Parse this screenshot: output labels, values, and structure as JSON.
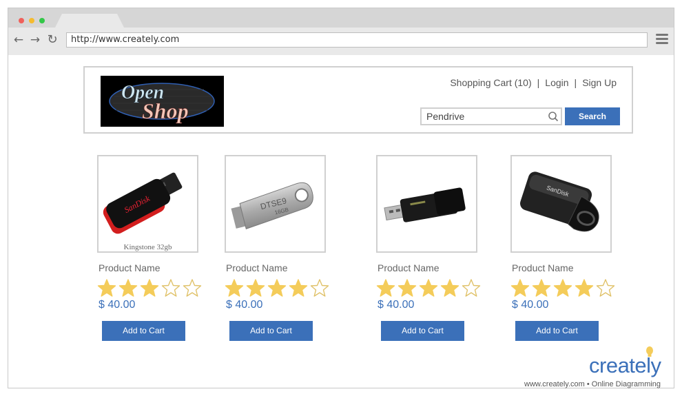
{
  "browser": {
    "url": "http://www.creately.com",
    "back_icon": "←",
    "forward_icon": "→",
    "reload_icon": "↻"
  },
  "store": {
    "logo_text_top": "Open",
    "logo_text_bottom": "Shop",
    "nav": {
      "cart": "Shopping Cart (10)",
      "login": "Login",
      "signup": "Sign Up",
      "separator": "|"
    },
    "search": {
      "value": "Pendrive",
      "button": "Search"
    }
  },
  "products": [
    {
      "caption": "Kingstone 32gb",
      "name": "Product Name",
      "rating": 3,
      "price": "$ 40.00",
      "button": "Add to Cart",
      "brand_mark": "SanDisk"
    },
    {
      "caption": "",
      "name": "Product Name",
      "rating": 4,
      "price": "$ 40.00",
      "button": "Add to Cart",
      "brand_mark": "DTSE9",
      "capacity_mark": "16GB"
    },
    {
      "caption": "",
      "name": "Product Name",
      "rating": 4,
      "price": "$ 40.00",
      "button": "Add to Cart"
    },
    {
      "caption": "",
      "name": "Product Name",
      "rating": 4,
      "price": "$ 40.00",
      "button": "Add to Cart",
      "brand_mark": "SanDisk"
    }
  ],
  "colors": {
    "accent": "#3b70b9",
    "star": "#f4cc5a",
    "star_empty_stroke": "#e0c26a"
  },
  "watermark": {
    "brand": "creately",
    "tagline": "www.creately.com • Online Diagramming"
  }
}
